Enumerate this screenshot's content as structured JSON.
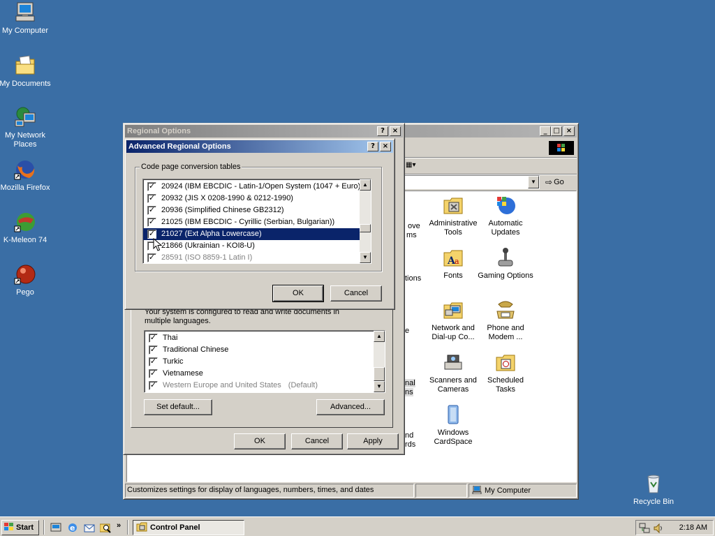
{
  "desktop": {
    "icons": [
      {
        "label": "My Computer",
        "icon": "my-computer-icon"
      },
      {
        "label": "My Documents",
        "icon": "my-documents-icon"
      },
      {
        "label": "My Network Places",
        "icon": "network-places-icon"
      },
      {
        "label": "Mozilla Firefox",
        "icon": "firefox-icon"
      },
      {
        "label": "K-Meleon 74",
        "icon": "k-meleon-icon"
      },
      {
        "label": "Pego",
        "icon": "pego-icon"
      }
    ],
    "recycle_bin": "Recycle Bin"
  },
  "control_panel": {
    "go_label": "Go",
    "status_left": "Customizes settings for display of languages, numbers, times, and dates",
    "status_right": "My Computer",
    "partial_labels": [
      "ove",
      "ms",
      "tions",
      "e",
      "nal",
      "ns",
      "nd",
      "rds"
    ],
    "items": [
      {
        "label": "Administrative Tools",
        "icon": "administrative-tools-icon"
      },
      {
        "label": "Automatic Updates",
        "icon": "automatic-updates-icon"
      },
      {
        "label": "Fonts",
        "icon": "fonts-icon"
      },
      {
        "label": "Gaming Options",
        "icon": "gaming-options-icon"
      },
      {
        "label": "Network and Dial-up Co...",
        "icon": "network-dialup-icon"
      },
      {
        "label": "Phone and Modem ...",
        "icon": "phone-modem-icon"
      },
      {
        "label": "Scanners and Cameras",
        "icon": "scanners-cameras-icon"
      },
      {
        "label": "Scheduled Tasks",
        "icon": "scheduled-tasks-icon"
      },
      {
        "label": "Windows CardSpace",
        "icon": "cardspace-icon"
      }
    ]
  },
  "regional_options": {
    "title": "Regional Options",
    "desc": "Your system is configured to read and write documents in multiple languages.",
    "languages": [
      {
        "label": "Thai",
        "checked": true,
        "dim": false
      },
      {
        "label": "Traditional Chinese",
        "checked": true,
        "dim": false
      },
      {
        "label": "Turkic",
        "checked": true,
        "dim": false
      },
      {
        "label": "Vietnamese",
        "checked": true,
        "dim": false
      },
      {
        "label": "Western Europe and United States",
        "suffix": "(Default)",
        "checked": true,
        "dim": true
      }
    ],
    "set_default": "Set default...",
    "advanced": "Advanced...",
    "ok": "OK",
    "cancel": "Cancel",
    "apply": "Apply"
  },
  "advanced_dialog": {
    "title": "Advanced Regional Options",
    "group_label": "Code page conversion tables",
    "code_pages": [
      {
        "label": "20924 (IBM EBCDIC - Latin-1/Open System (1047 + Euro))",
        "checked": true,
        "selected": false,
        "dim": false
      },
      {
        "label": "20932 (JIS X 0208-1990 & 0212-1990)",
        "checked": true,
        "selected": false,
        "dim": false
      },
      {
        "label": "20936 (Simplified Chinese GB2312)",
        "checked": true,
        "selected": false,
        "dim": false
      },
      {
        "label": "21025 (IBM EBCDIC - Cyrillic (Serbian, Bulgarian))",
        "checked": true,
        "selected": false,
        "dim": false
      },
      {
        "label": "21027 (Ext Alpha Lowercase)",
        "checked": true,
        "selected": true,
        "dim": false
      },
      {
        "label": "21866 (Ukrainian - KOI8-U)",
        "checked": false,
        "selected": false,
        "dim": false
      },
      {
        "label": "28591 (ISO 8859-1 Latin I)",
        "checked": true,
        "selected": false,
        "dim": true
      }
    ],
    "ok": "OK",
    "cancel": "Cancel"
  },
  "taskbar": {
    "start": "Start",
    "task": "Control Panel",
    "clock": "2:18 AM",
    "quicklaunch": [
      "show-desktop-icon",
      "internet-explorer-icon",
      "outlook-express-icon",
      "search-icon"
    ]
  },
  "colors": {
    "desktop": "#3a6ea5",
    "selection": "#0a246a",
    "face": "#d4d0c8"
  }
}
